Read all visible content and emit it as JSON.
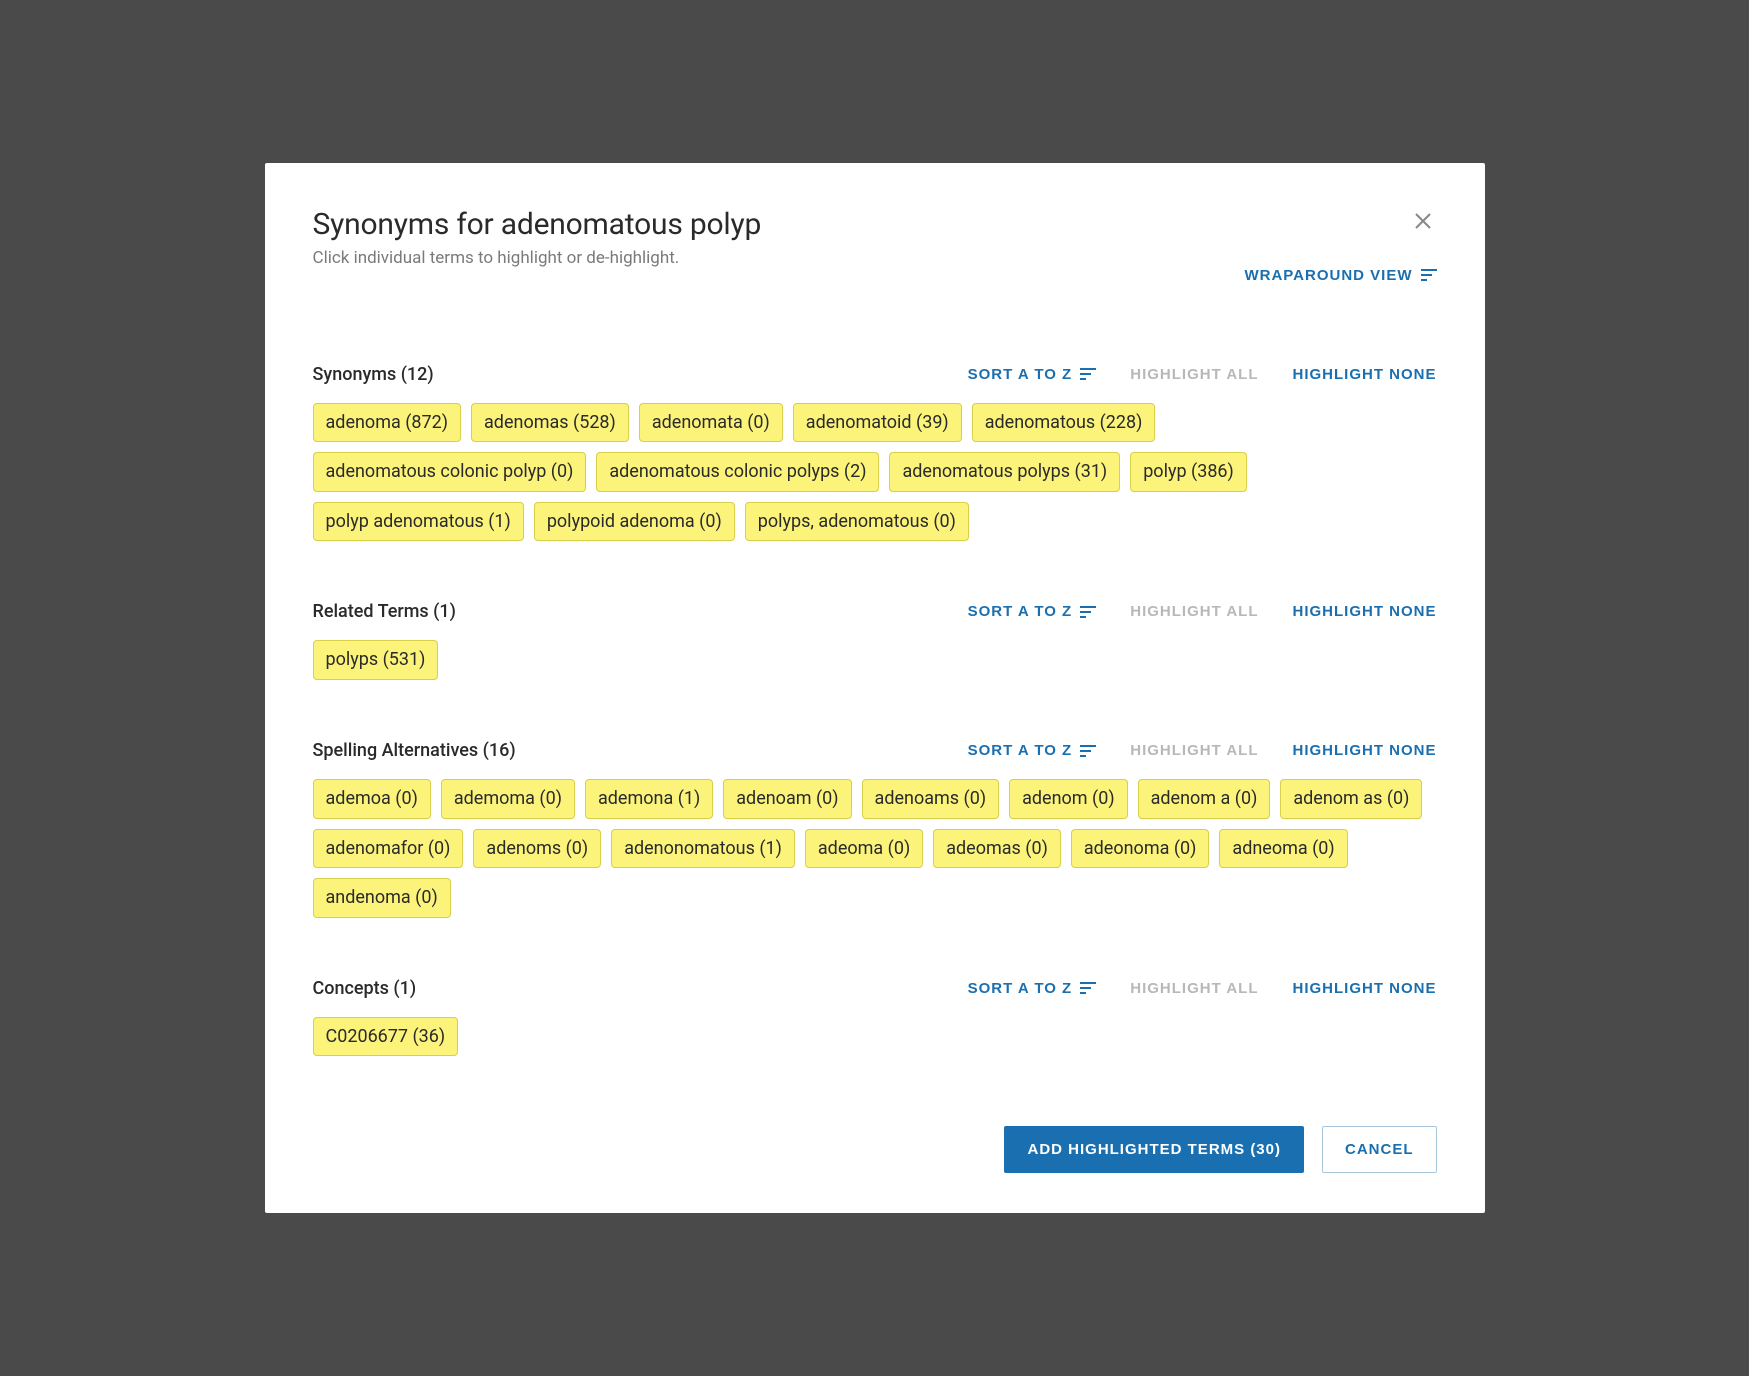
{
  "header": {
    "title": "Synonyms for adenomatous polyp",
    "subtitle": "Click individual terms to highlight or de-highlight.",
    "wraparound_label": "WRAPAROUND VIEW"
  },
  "actions": {
    "sort_label": "SORT A TO Z",
    "highlight_all_label": "HIGHLIGHT ALL",
    "highlight_none_label": "HIGHLIGHT NONE"
  },
  "sections": [
    {
      "title": "Synonyms (12)",
      "chips": [
        "adenoma (872)",
        "adenomas (528)",
        "adenomata (0)",
        "adenomatoid (39)",
        "adenomatous (228)",
        "adenomatous colonic polyp (0)",
        "adenomatous colonic polyps (2)",
        "adenomatous polyps (31)",
        "polyp (386)",
        "polyp adenomatous (1)",
        "polypoid adenoma (0)",
        "polyps, adenomatous (0)"
      ]
    },
    {
      "title": "Related Terms (1)",
      "chips": [
        "polyps (531)"
      ]
    },
    {
      "title": "Spelling Alternatives (16)",
      "chips": [
        "ademoa (0)",
        "ademoma (0)",
        "ademona (1)",
        "adenoam (0)",
        "adenoams (0)",
        "adenom (0)",
        "adenom a (0)",
        "adenom as (0)",
        "adenomafor (0)",
        "adenoms (0)",
        "adenonomatous (1)",
        "adeoma (0)",
        "adeomas (0)",
        "adeonoma (0)",
        "adneoma (0)",
        "andenoma (0)"
      ]
    },
    {
      "title": "Concepts (1)",
      "chips": [
        "C0206677 (36)"
      ]
    }
  ],
  "footer": {
    "primary_label": "ADD HIGHLIGHTED TERMS (30)",
    "cancel_label": "CANCEL"
  }
}
